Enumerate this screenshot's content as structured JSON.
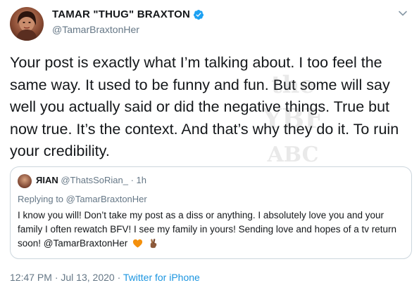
{
  "tweet": {
    "display_name": "TAMAR \"THUG\" BRAXTON",
    "handle": "@TamarBraxtonHer",
    "text": "Your post is exactly what I’m talking about. I too feel the same way. It used to be funny and fun. But some will say well you actually said or did the negative things. True but now true. It’s the context. And that’s why they do it. To ruin your credibility.",
    "time": "12:47 PM",
    "date": "Jul 13, 2020",
    "source": "Twitter for iPhone",
    "separator": "·"
  },
  "quoted": {
    "display_name": "ЯIAN",
    "handle": "@ThatsSoRian_",
    "separator": "·",
    "time": "1h",
    "replying_prefix": "Replying to",
    "replying_to": "@TamarBraxtonHer",
    "text": "I know you will! Don’t take my post as a diss or anything. I absolutely love you and your family I often rewatch BFV! I see my family in yours! Sending love and hopes of a tv return soon! @TamarBraxtonHer",
    "emojis": [
      "orange-heart-icon",
      "fingers-crossed-icon"
    ]
  },
  "icons": {
    "verified": "verified-badge-icon",
    "menu": "chevron-down-icon"
  },
  "colors": {
    "text": "#14171a",
    "muted": "#657786",
    "link": "#1b95e0",
    "verified": "#1da1f2",
    "border": "#ccd6dd"
  }
}
